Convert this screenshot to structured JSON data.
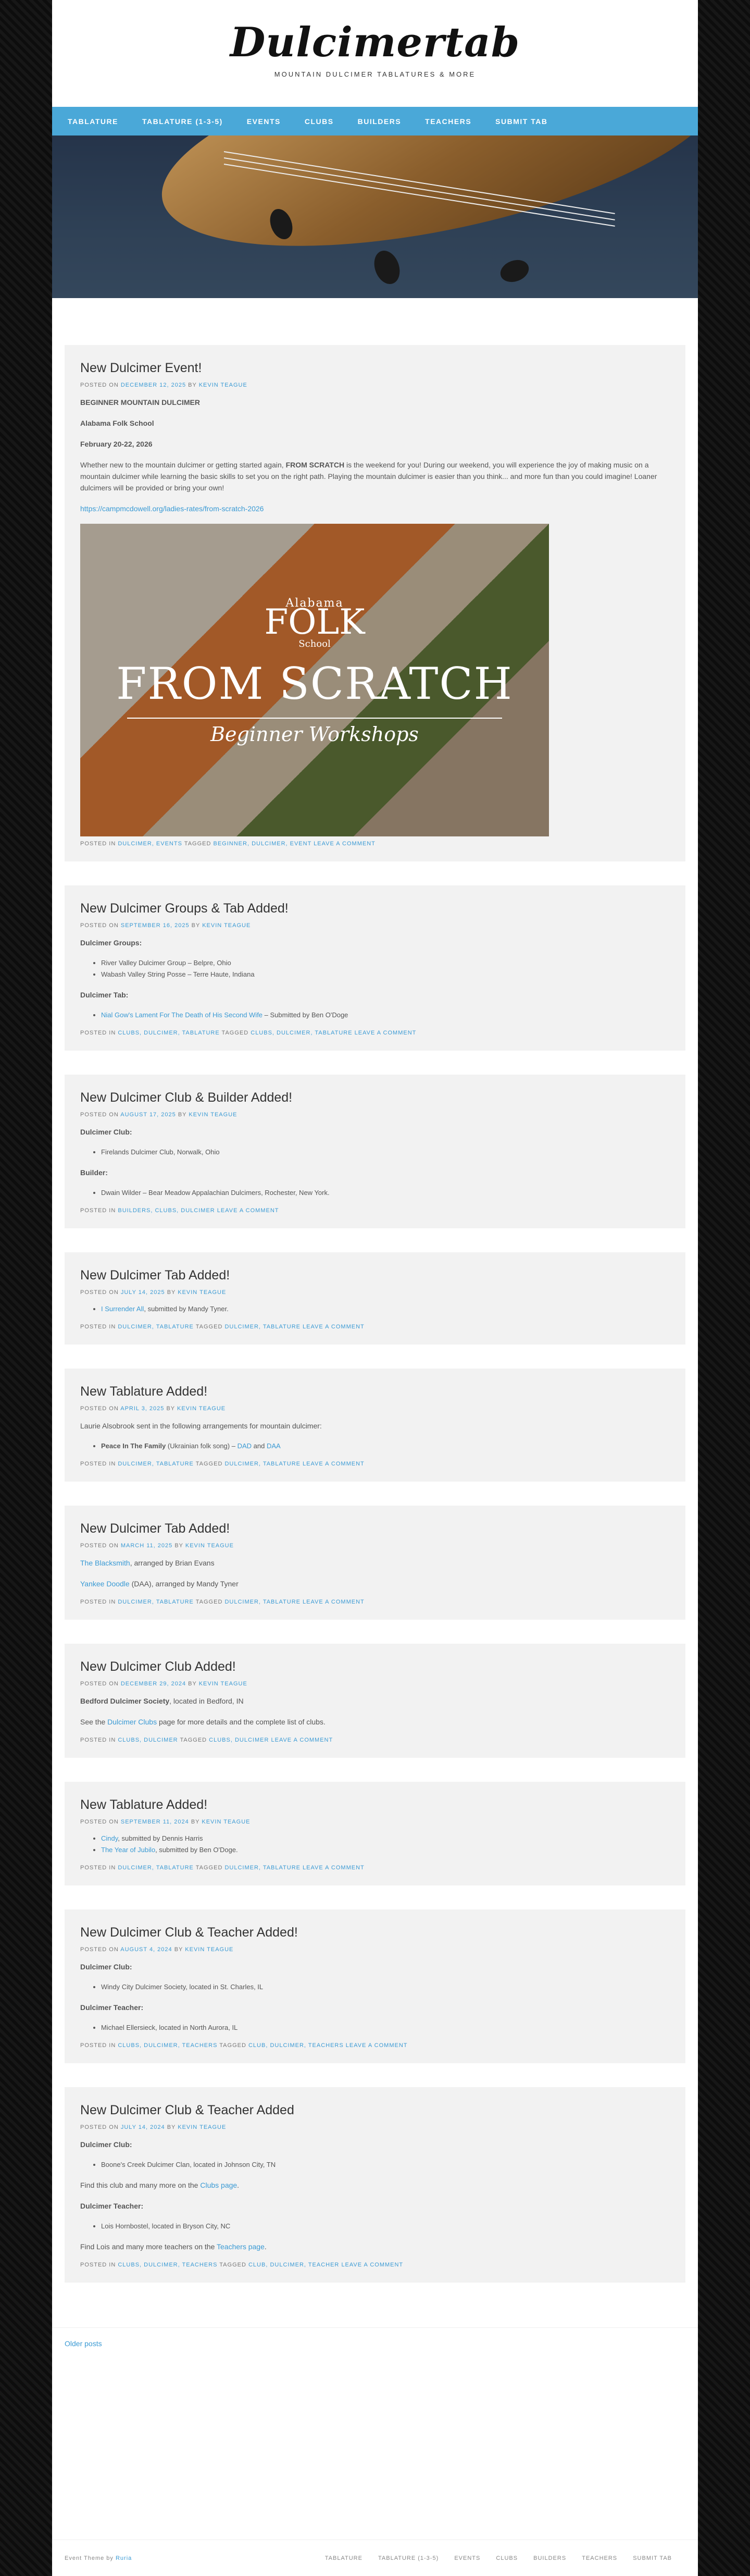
{
  "site": {
    "title": "Dulcimertab",
    "tagline": "MOUNTAIN DULCIMER TABLATURES & MORE"
  },
  "nav": [
    "TABLATURE",
    "TABLATURE (1-3-5)",
    "EVENTS",
    "CLUBS",
    "BUILDERS",
    "TEACHERS",
    "SUBMIT TAB"
  ],
  "posts": [
    {
      "title": "New Dulcimer Event!",
      "meta": {
        "posted_on": "POSTED ON",
        "date": "DECEMBER 12, 2025",
        "by": "BY",
        "author": "KEVIN TEAGUE"
      },
      "lines": [
        "BEGINNER MOUNTAIN DULCIMER",
        "Alabama Folk School",
        "February 20-22, 2026"
      ],
      "body_pre": "Whether new to the mountain dulcimer or getting started again, ",
      "body_bold": "FROM SCRATCH",
      "body_post": " is the weekend for you! During our weekend, you will experience the joy of making music on a mountain dulcimer while learning the basic skills to set you on the right path. Playing the mountain dulcimer is easier than you think... and more fun than you could imagine! Loaner dulcimers will be provided or bring your own!",
      "link": "https://campmcdowell.org/ladies-rates/from-scratch-2026",
      "image": {
        "line1": "Alabama",
        "line2": "FOLK",
        "line3": "School",
        "line4": "FROM SCRATCH",
        "line5": "Beginner Workshops"
      },
      "footer": {
        "posted_in": "POSTED IN",
        "cats": "DULCIMER, EVENTS",
        "tagged": "TAGGED",
        "tags": "BEGINNER, DULCIMER, EVENT",
        "comment": "LEAVE A COMMENT"
      }
    },
    {
      "title": "New Dulcimer Groups & Tab Added!",
      "meta": {
        "posted_on": "POSTED ON",
        "date": "SEPTEMBER 16, 2025",
        "by": "BY",
        "author": "KEVIN TEAGUE"
      },
      "sec1": "Dulcimer Groups:",
      "groups": [
        "River Valley Dulcimer Group – Belpre, Ohio",
        "Wabash Valley String Posse – Terre Haute, Indiana"
      ],
      "sec2": "Dulcimer Tab:",
      "tab_link": "Nial Gow's Lament For The Death of His Second Wife",
      "tab_rest": " – Submitted by Ben O'Doge",
      "footer": {
        "posted_in": "POSTED IN",
        "cats": "CLUBS, DULCIMER, TABLATURE",
        "tagged": "TAGGED",
        "tags": "CLUBS, DULCIMER, TABLATURE",
        "comment": "LEAVE A COMMENT"
      }
    },
    {
      "title": "New Dulcimer Club & Builder Added!",
      "meta": {
        "posted_on": "POSTED ON",
        "date": "AUGUST 17, 2025",
        "by": "BY",
        "author": "KEVIN TEAGUE"
      },
      "sec1": "Dulcimer Club:",
      "clubs": [
        "Firelands Dulcimer Club, Norwalk, Ohio"
      ],
      "sec2": "Builder:",
      "builders": [
        "Dwain Wilder – Bear Meadow Appalachian Dulcimers, Rochester, New York."
      ],
      "footer": {
        "posted_in": "POSTED IN",
        "cats": "BUILDERS, CLUBS, DULCIMER",
        "comment": "LEAVE A COMMENT"
      }
    },
    {
      "title": "New Dulcimer Tab Added!",
      "meta": {
        "posted_on": "POSTED ON",
        "date": "JULY 14, 2025",
        "by": "BY",
        "author": "KEVIN TEAGUE"
      },
      "item_link": "I Surrender All",
      "item_rest": ", submitted by Mandy Tyner.",
      "footer": {
        "posted_in": "POSTED IN",
        "cats": "DULCIMER, TABLATURE",
        "tagged": "TAGGED",
        "tags": "DULCIMER, TABLATURE",
        "comment": "LEAVE A COMMENT"
      }
    },
    {
      "title": "New Tablature Added!",
      "meta": {
        "posted_on": "POSTED ON",
        "date": "APRIL 3, 2025",
        "by": "BY",
        "author": "KEVIN TEAGUE"
      },
      "intro": "Laurie Alsobrook sent in the following arrangements for mountain dulcimer:",
      "item_bold": "Peace In The Family",
      "item_mid": " (Ukrainian folk song) – ",
      "item_link1": "DAD",
      "item_and": " and ",
      "item_link2": "DAA",
      "footer": {
        "posted_in": "POSTED IN",
        "cats": "DULCIMER, TABLATURE",
        "tagged": "TAGGED",
        "tags": "DULCIMER, TABLATURE",
        "comment": "LEAVE A COMMENT"
      }
    },
    {
      "title": "New Dulcimer Tab Added!",
      "meta": {
        "posted_on": "POSTED ON",
        "date": "MARCH 11, 2025",
        "by": "BY",
        "author": "KEVIN TEAGUE"
      },
      "p1_link": "The Blacksmith",
      "p1_rest": ", arranged by Brian Evans",
      "p2_link": "Yankee Doodle",
      "p2_rest": " (DAA), arranged by Mandy Tyner",
      "footer": {
        "posted_in": "POSTED IN",
        "cats": "DULCIMER, TABLATURE",
        "tagged": "TAGGED",
        "tags": "DULCIMER, TABLATURE",
        "comment": "LEAVE A COMMENT"
      }
    },
    {
      "title": "New Dulcimer Club Added!",
      "meta": {
        "posted_on": "POSTED ON",
        "date": "DECEMBER 29, 2024",
        "by": "BY",
        "author": "KEVIN TEAGUE"
      },
      "p1_bold": "Bedford Dulcimer Society",
      "p1_rest": ", located in Bedford, IN",
      "p2_pre": "See the ",
      "p2_link": "Dulcimer Clubs",
      "p2_post": " page for more details and the complete list of clubs.",
      "footer": {
        "posted_in": "POSTED IN",
        "cats": "CLUBS, DULCIMER",
        "tagged": "TAGGED",
        "tags": "CLUBS, DULCIMER",
        "comment": "LEAVE A COMMENT"
      }
    },
    {
      "title": "New Tablature Added!",
      "meta": {
        "posted_on": "POSTED ON",
        "date": "SEPTEMBER 11, 2024",
        "by": "BY",
        "author": "KEVIN TEAGUE"
      },
      "i1_link": "Cindy",
      "i1_rest": ", submitted by Dennis Harris",
      "i2_link": "The Year of Jubilo",
      "i2_rest": ", submitted by Ben O'Doge.",
      "footer": {
        "posted_in": "POSTED IN",
        "cats": "DULCIMER, TABLATURE",
        "tagged": "TAGGED",
        "tags": "DULCIMER, TABLATURE",
        "comment": "LEAVE A COMMENT"
      }
    },
    {
      "title": "New Dulcimer Club & Teacher Added!",
      "meta": {
        "posted_on": "POSTED ON",
        "date": "AUGUST 4, 2024",
        "by": "BY",
        "author": "KEVIN TEAGUE"
      },
      "sec1": "Dulcimer Club:",
      "club": "Windy City Dulcimer Society, located in St. Charles, IL",
      "sec2": "Dulcimer Teacher:",
      "teacher": "Michael Ellersieck, located in North Aurora, IL",
      "footer": {
        "posted_in": "POSTED IN",
        "cats": "CLUBS, DULCIMER, TEACHERS",
        "tagged": "TAGGED",
        "tags": "CLUB, DULCIMER, TEACHERS",
        "comment": "LEAVE A COMMENT"
      }
    },
    {
      "title": "New Dulcimer Club & Teacher Added",
      "meta": {
        "posted_on": "POSTED ON",
        "date": "JULY 14, 2024",
        "by": "BY",
        "author": "KEVIN TEAGUE"
      },
      "sec1": "Dulcimer Club:",
      "club": "Boone's Creek Dulcimer Clan, located in Johnson City, TN",
      "p1_pre": "Find this club and many more on the ",
      "p1_link": "Clubs page",
      "p1_post": ".",
      "sec2": "Dulcimer Teacher:",
      "teacher": "Lois Hornbostel, located in Bryson City, NC",
      "p2_pre": "Find Lois and many more teachers on the ",
      "p2_link": "Teachers page",
      "p2_post": ".",
      "footer": {
        "posted_in": "POSTED IN",
        "cats": "CLUBS, DULCIMER, TEACHERS",
        "tagged": "TAGGED",
        "tags": "CLUB, DULCIMER, TEACHER",
        "comment": "LEAVE A COMMENT"
      }
    }
  ],
  "older_posts": "Older posts",
  "footer": {
    "credit_pre": "Event Theme by",
    "credit_link": "Ruria",
    "nav": [
      "TABLATURE",
      "TABLATURE (1-3-5)",
      "EVENTS",
      "CLUBS",
      "BUILDERS",
      "TEACHERS",
      "SUBMIT TAB"
    ]
  },
  "colors": {
    "accent": "#4aa8d8",
    "link": "#3a9ad4",
    "post_bg": "#f2f2f2"
  }
}
